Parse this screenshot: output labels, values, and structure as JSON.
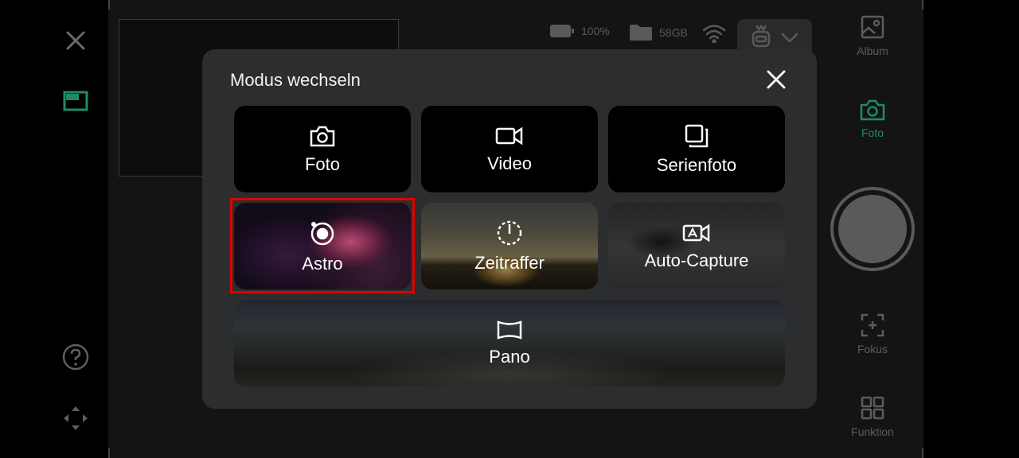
{
  "status": {
    "battery": "100%",
    "storage": "58GB"
  },
  "sidebar": {
    "album_label": "Album",
    "foto_label": "Foto",
    "fokus_label": "Fokus",
    "funktion_label": "Funktion"
  },
  "modal": {
    "title": "Modus wechseln",
    "modes": [
      {
        "label": "Foto",
        "icon": "camera-icon"
      },
      {
        "label": "Video",
        "icon": "video-camera-icon"
      },
      {
        "label": "Serienfoto",
        "icon": "burst-icon"
      },
      {
        "label": "Astro",
        "icon": "astro-orbit-icon",
        "selected": true
      },
      {
        "label": "Zeitraffer",
        "icon": "timelapse-dial-icon"
      },
      {
        "label": "Auto-Capture",
        "icon": "auto-video-icon"
      },
      {
        "label": "Pano",
        "icon": "panorama-icon"
      }
    ]
  },
  "colors": {
    "accent_green": "#1f8a6a",
    "highlight_red": "#e00000",
    "modal_bg": "#2c2d2e"
  }
}
